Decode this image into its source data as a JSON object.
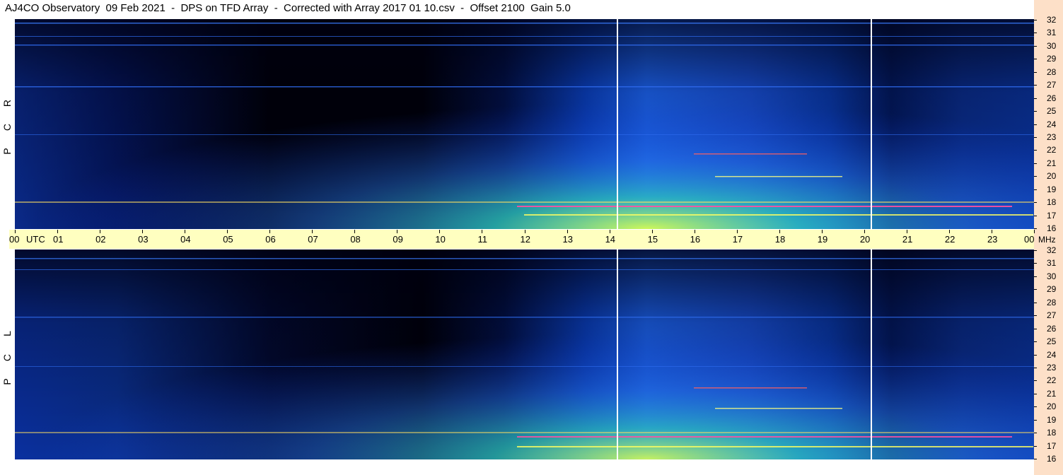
{
  "title": "AJ4CO Observatory  09 Feb 2021  -  DPS on TFD Array  -  Corrected with Array 2017 01 10.csv  -  Offset 2100  Gain 5.0",
  "time_axis": {
    "unit_label": "UTC",
    "freq_unit_label": "MHz",
    "hours": [
      "00",
      "01",
      "02",
      "03",
      "04",
      "05",
      "06",
      "07",
      "08",
      "09",
      "10",
      "11",
      "12",
      "13",
      "14",
      "15",
      "16",
      "17",
      "18",
      "19",
      "20",
      "21",
      "22",
      "23",
      "00"
    ]
  },
  "panels": [
    {
      "id": "rcp",
      "side_label": [
        "R",
        "C",
        "P"
      ]
    },
    {
      "id": "lcp",
      "side_label": [
        "L",
        "C",
        "P"
      ]
    }
  ],
  "chart_data": {
    "type": "heatmap",
    "title": "AJ4CO Observatory  09 Feb 2021  -  DPS on TFD Array  -  Corrected with Array 2017 01 10.csv  -  Offset 2100  Gain 5.0",
    "xlabel": "UTC",
    "ylabel": "MHz",
    "xlim": [
      0,
      24
    ],
    "ylim": [
      16,
      32
    ],
    "x_ticks": [
      "00",
      "01",
      "02",
      "03",
      "04",
      "05",
      "06",
      "07",
      "08",
      "09",
      "10",
      "11",
      "12",
      "13",
      "14",
      "15",
      "16",
      "17",
      "18",
      "19",
      "20",
      "21",
      "22",
      "23",
      "00"
    ],
    "y_ticks": [
      16,
      17,
      18,
      19,
      20,
      21,
      22,
      23,
      24,
      25,
      26,
      27,
      28,
      29,
      30,
      31,
      32
    ],
    "panels": [
      "RCP",
      "LCP"
    ],
    "colormap": [
      "#000010",
      "#001a70",
      "#0035c8",
      "#2a78ff",
      "#27d0c8",
      "#b8f040",
      "#ffff60",
      "#ff6040"
    ],
    "vertical_lines_utc": [
      14.2,
      20.2
    ]
  }
}
